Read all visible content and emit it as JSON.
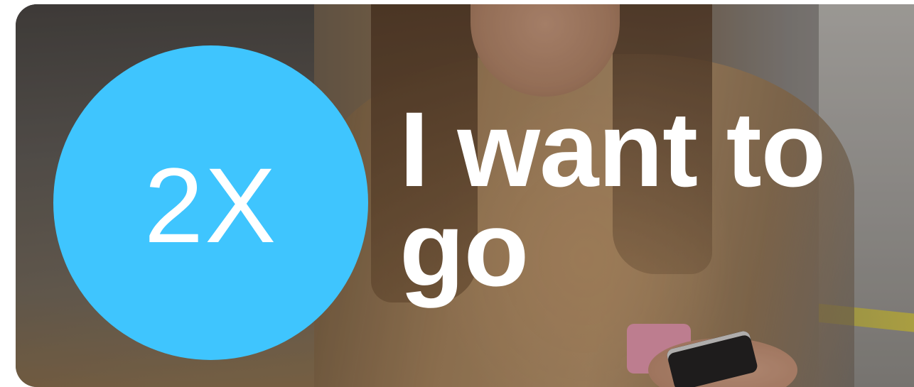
{
  "badge": {
    "label": "2X",
    "color": "#3fc5fe"
  },
  "headline": {
    "line1": "I want to",
    "line2": "go"
  }
}
